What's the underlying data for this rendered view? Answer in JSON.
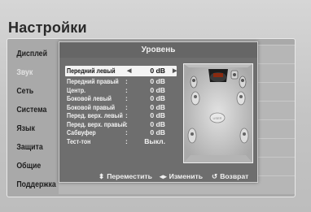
{
  "header": {
    "title": "Настройки"
  },
  "sidebar": {
    "items": [
      {
        "label": "Дисплей"
      },
      {
        "label": "Звук"
      },
      {
        "label": "Сеть"
      },
      {
        "label": "Система"
      },
      {
        "label": "Язык"
      },
      {
        "label": "Защита"
      },
      {
        "label": "Общие"
      },
      {
        "label": "Поддержка"
      }
    ]
  },
  "dialog": {
    "title": "Уровень",
    "settings": [
      {
        "label": "Передний левый",
        "value": "0 dB"
      },
      {
        "label": "Передний правый",
        "value": "0 dB"
      },
      {
        "label": "Центр.",
        "value": "0 dB"
      },
      {
        "label": "Боковой левый",
        "value": "0 dB"
      },
      {
        "label": "Боковой правый",
        "value": "0 dB"
      },
      {
        "label": "Перед. верх. левый",
        "value": "0 dB"
      },
      {
        "label": "Перед. верх. правый",
        "value": "0 dB"
      },
      {
        "label": "Сабвуфер",
        "value": "0 dB"
      },
      {
        "label": "Тест-тон",
        "value": "Выкл."
      }
    ],
    "separator": ":",
    "footer": {
      "move": "Переместить",
      "change": "Изменить",
      "back": "Возврат"
    }
  },
  "icons": {
    "move": "up-down-arrows-icon",
    "change": "left-right-arrows-icon",
    "back": "return-icon"
  }
}
